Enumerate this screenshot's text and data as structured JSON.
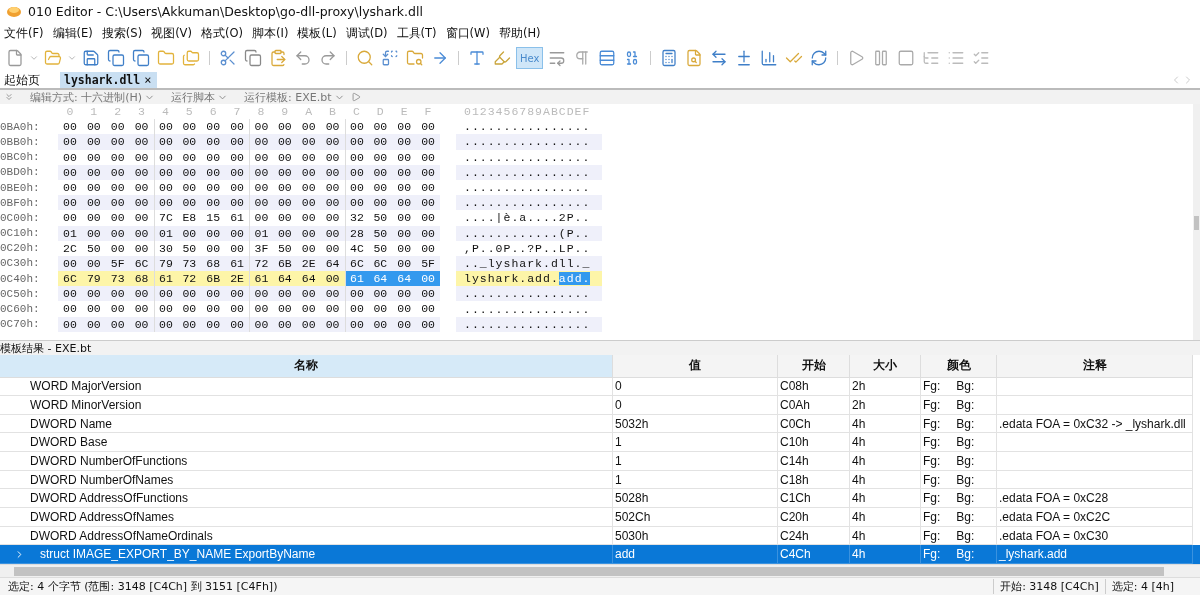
{
  "window": {
    "title": "010 Editor - C:\\Users\\Akkuman\\Desktop\\go-dll-proxy\\lyshark.dll"
  },
  "menu": [
    "文件(F)",
    "编辑(E)",
    "搜索(S)",
    "视图(V)",
    "格式(O)",
    "脚本(I)",
    "模板(L)",
    "调试(D)",
    "工具(T)",
    "窗口(W)",
    "帮助(H)"
  ],
  "toolbar": {
    "hex_button": {
      "label": "Hex",
      "pressed": true
    }
  },
  "tabs": [
    {
      "label": "起始页",
      "selected": false
    },
    {
      "label": "lyshark.dll",
      "selected": true,
      "close": "×"
    }
  ],
  "editor_bar": [
    {
      "label": "编辑方式: 十六进制(H)"
    },
    {
      "label": "运行脚本"
    },
    {
      "label": "运行模板: EXE.bt"
    }
  ],
  "hex_view": {
    "column_labels": [
      "0",
      "1",
      "2",
      "3",
      "4",
      "5",
      "6",
      "7",
      "8",
      "9",
      "A",
      "B",
      "C",
      "D",
      "E",
      "F"
    ],
    "ascii_header": "0123456789ABCDEF",
    "rows": [
      {
        "offset": "0BA0h:",
        "highlighted": false,
        "bytes": [
          "00",
          "00",
          "00",
          "00",
          "00",
          "00",
          "00",
          "00",
          "00",
          "00",
          "00",
          "00",
          "00",
          "00",
          "00",
          "00"
        ],
        "ascii": "................"
      },
      {
        "offset": "0BB0h:",
        "highlighted": false,
        "bytes": [
          "00",
          "00",
          "00",
          "00",
          "00",
          "00",
          "00",
          "00",
          "00",
          "00",
          "00",
          "00",
          "00",
          "00",
          "00",
          "00"
        ],
        "ascii": "................"
      },
      {
        "offset": "0BC0h:",
        "highlighted": false,
        "bytes": [
          "00",
          "00",
          "00",
          "00",
          "00",
          "00",
          "00",
          "00",
          "00",
          "00",
          "00",
          "00",
          "00",
          "00",
          "00",
          "00"
        ],
        "ascii": "................"
      },
      {
        "offset": "0BD0h:",
        "highlighted": false,
        "bytes": [
          "00",
          "00",
          "00",
          "00",
          "00",
          "00",
          "00",
          "00",
          "00",
          "00",
          "00",
          "00",
          "00",
          "00",
          "00",
          "00"
        ],
        "ascii": "................"
      },
      {
        "offset": "0BE0h:",
        "highlighted": false,
        "bytes": [
          "00",
          "00",
          "00",
          "00",
          "00",
          "00",
          "00",
          "00",
          "00",
          "00",
          "00",
          "00",
          "00",
          "00",
          "00",
          "00"
        ],
        "ascii": "................"
      },
      {
        "offset": "0BF0h:",
        "highlighted": false,
        "bytes": [
          "00",
          "00",
          "00",
          "00",
          "00",
          "00",
          "00",
          "00",
          "00",
          "00",
          "00",
          "00",
          "00",
          "00",
          "00",
          "00"
        ],
        "ascii": "................"
      },
      {
        "offset": "0C00h:",
        "highlighted": false,
        "bytes": [
          "00",
          "00",
          "00",
          "00",
          "7C",
          "E8",
          "15",
          "61",
          "00",
          "00",
          "00",
          "00",
          "32",
          "50",
          "00",
          "00"
        ],
        "ascii": "....|è.a....2P.."
      },
      {
        "offset": "0C10h:",
        "highlighted": false,
        "bytes": [
          "01",
          "00",
          "00",
          "00",
          "01",
          "00",
          "00",
          "00",
          "01",
          "00",
          "00",
          "00",
          "28",
          "50",
          "00",
          "00"
        ],
        "ascii": "............(P.."
      },
      {
        "offset": "0C20h:",
        "highlighted": false,
        "bytes": [
          "2C",
          "50",
          "00",
          "00",
          "30",
          "50",
          "00",
          "00",
          "3F",
          "50",
          "00",
          "00",
          "4C",
          "50",
          "00",
          "00"
        ],
        "ascii": ",P..0P..?P..LP.."
      },
      {
        "offset": "0C30h:",
        "highlighted": false,
        "bytes": [
          "00",
          "00",
          "5F",
          "6C",
          "79",
          "73",
          "68",
          "61",
          "72",
          "6B",
          "2E",
          "64",
          "6C",
          "6C",
          "00",
          "5F"
        ],
        "ascii": ".._lyshark.dll._"
      },
      {
        "offset": "0C40h:",
        "highlighted": true,
        "bytes": [
          "6C",
          "79",
          "73",
          "68",
          "61",
          "72",
          "6B",
          "2E",
          "61",
          "64",
          "64",
          "00"
        ],
        "selected_bytes": [
          "61",
          "64",
          "64",
          "00"
        ],
        "ascii": "lyshark.add.",
        "ascii_selected": "add."
      },
      {
        "offset": "0C50h:",
        "highlighted": false,
        "bytes": [
          "00",
          "00",
          "00",
          "00",
          "00",
          "00",
          "00",
          "00",
          "00",
          "00",
          "00",
          "00",
          "00",
          "00",
          "00",
          "00"
        ],
        "ascii": "................"
      },
      {
        "offset": "0C60h:",
        "highlighted": false,
        "bytes": [
          "00",
          "00",
          "00",
          "00",
          "00",
          "00",
          "00",
          "00",
          "00",
          "00",
          "00",
          "00",
          "00",
          "00",
          "00",
          "00"
        ],
        "ascii": "................"
      },
      {
        "offset": "0C70h:",
        "highlighted": false,
        "bytes": [
          "00",
          "00",
          "00",
          "00",
          "00",
          "00",
          "00",
          "00",
          "00",
          "00",
          "00",
          "00",
          "00",
          "00",
          "00",
          "00"
        ],
        "ascii": "................"
      }
    ]
  },
  "template_results": {
    "title": "模板结果 - EXE.bt",
    "columns": [
      "名称",
      "值",
      "开始",
      "大小",
      "颜色",
      "注释"
    ],
    "rows": [
      {
        "name": "WORD MajorVersion",
        "value": "0",
        "start": "C08h",
        "size": "2h",
        "fg": "Fg:",
        "bg": "Bg:",
        "selected": false,
        "expandable": false
      },
      {
        "name": "WORD MinorVersion",
        "value": "0",
        "start": "C0Ah",
        "size": "2h",
        "fg": "Fg:",
        "bg": "Bg:",
        "selected": false,
        "expandable": false
      },
      {
        "name": "DWORD Name",
        "value": "5032h",
        "start": "C0Ch",
        "size": "4h",
        "fg": "Fg:",
        "bg": "Bg:",
        "comment": ".edata FOA = 0xC32 -> _lyshark.dll",
        "selected": false,
        "expandable": false
      },
      {
        "name": "DWORD Base",
        "value": "1",
        "start": "C10h",
        "size": "4h",
        "fg": "Fg:",
        "bg": "Bg:",
        "selected": false,
        "expandable": false
      },
      {
        "name": "DWORD NumberOfFunctions",
        "value": "1",
        "start": "C14h",
        "size": "4h",
        "fg": "Fg:",
        "bg": "Bg:",
        "selected": false,
        "expandable": false
      },
      {
        "name": "DWORD NumberOfNames",
        "value": "1",
        "start": "C18h",
        "size": "4h",
        "fg": "Fg:",
        "bg": "Bg:",
        "selected": false,
        "expandable": false
      },
      {
        "name": "DWORD AddressOfFunctions",
        "value": "5028h",
        "start": "C1Ch",
        "size": "4h",
        "fg": "Fg:",
        "bg": "Bg:",
        "comment": ".edata FOA = 0xC28",
        "selected": false,
        "expandable": false
      },
      {
        "name": "DWORD AddressOfNames",
        "value": "502Ch",
        "start": "C20h",
        "size": "4h",
        "fg": "Fg:",
        "bg": "Bg:",
        "comment": ".edata FOA = 0xC2C",
        "selected": false,
        "expandable": false
      },
      {
        "name": "DWORD AddressOfNameOrdinals",
        "value": "5030h",
        "start": "C24h",
        "size": "4h",
        "fg": "Fg:",
        "bg": "Bg:",
        "comment": ".edata FOA = 0xC30",
        "selected": false,
        "expandable": false
      },
      {
        "name": "struct IMAGE_EXPORT_BY_NAME ExportByName",
        "value": "add",
        "start": "C4Ch",
        "size": "4h",
        "fg": "Fg:",
        "bg": "Bg:",
        "comment": "_lyshark.add",
        "selected": true,
        "expandable": true
      }
    ]
  },
  "status_bar": {
    "selection": "选定: 4 个字节 (范围: 3148 [C4Ch] 到 3151 [C4Fh])",
    "start": "开始: 3148 [C4Ch]",
    "size": "选定: 4 [4h]"
  }
}
